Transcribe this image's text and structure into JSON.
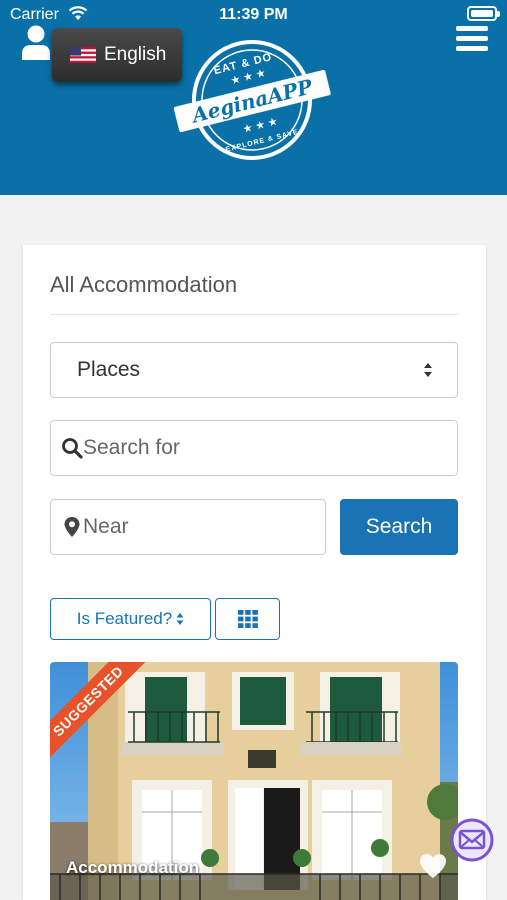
{
  "status_bar": {
    "carrier": "Carrier",
    "time": "11:39 PM"
  },
  "header": {
    "language": "English",
    "logo": {
      "text": "AeginaAPP",
      "top_text": "EAT & DO",
      "bottom_text": "EXPLORE & SAVE"
    }
  },
  "main": {
    "title": "All Accommodation",
    "select_value": "Places",
    "search": {
      "placeholder": "Search for"
    },
    "near": {
      "placeholder": "Near"
    },
    "search_button": "Search",
    "featured_label": "Is Featured?",
    "listing": {
      "badge": "SUGGESTED",
      "category": "Accommodation"
    }
  },
  "colors": {
    "header": "#0a71a8",
    "primary": "#1a73b5",
    "ribbon": "#e8522a"
  }
}
